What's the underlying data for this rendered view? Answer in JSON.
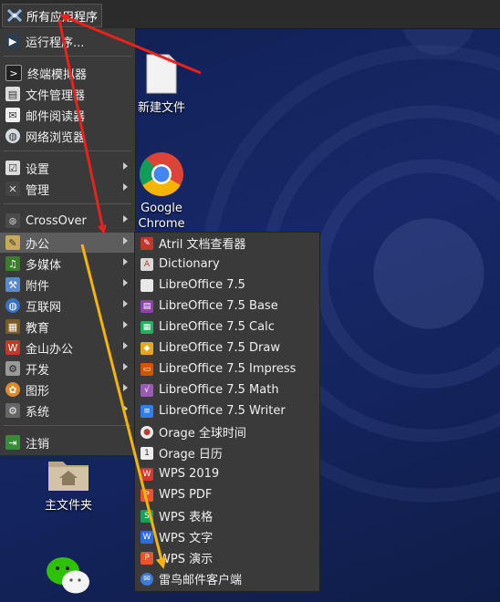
{
  "topbar": {
    "apps_label": "所有应用程序"
  },
  "menu": {
    "run": "运行程序...",
    "quick": [
      {
        "label": "终端模拟器",
        "icon": "terminal-icon"
      },
      {
        "label": "文件管理器",
        "icon": "file-manager-icon"
      },
      {
        "label": "邮件阅读器",
        "icon": "mail-reader-icon"
      },
      {
        "label": "网络浏览器",
        "icon": "web-browser-icon"
      }
    ],
    "settings": [
      {
        "label": "设置",
        "icon": "settings-icon"
      },
      {
        "label": "管理",
        "icon": "admin-icon"
      }
    ],
    "crossover": "CrossOver",
    "categories": [
      {
        "label": "办公",
        "icon": "office-icon"
      },
      {
        "label": "多媒体",
        "icon": "multimedia-icon"
      },
      {
        "label": "附件",
        "icon": "accessories-icon"
      },
      {
        "label": "互联网",
        "icon": "internet-icon"
      },
      {
        "label": "教育",
        "icon": "education-icon"
      },
      {
        "label": "金山办公",
        "icon": "kingsoft-office-icon"
      },
      {
        "label": "开发",
        "icon": "development-icon"
      },
      {
        "label": "图形",
        "icon": "graphics-icon"
      },
      {
        "label": "系统",
        "icon": "system-icon"
      }
    ],
    "logout": "注销"
  },
  "submenu": {
    "items": [
      {
        "label": "Atril 文档查看器",
        "icon": "atril-icon",
        "color": "#c0392b"
      },
      {
        "label": "Dictionary",
        "icon": "dictionary-icon",
        "color": "#d9d9d9"
      },
      {
        "label": "LibreOffice 7.5",
        "icon": "libreoffice-icon",
        "color": "#e0e0e0"
      },
      {
        "label": "LibreOffice 7.5 Base",
        "icon": "libreoffice-base-icon",
        "color": "#8e44ad"
      },
      {
        "label": "LibreOffice 7.5 Calc",
        "icon": "libreoffice-calc-icon",
        "color": "#27ae60"
      },
      {
        "label": "LibreOffice 7.5 Draw",
        "icon": "libreoffice-draw-icon",
        "color": "#e6a817"
      },
      {
        "label": "LibreOffice 7.5 Impress",
        "icon": "libreoffice-impress-icon",
        "color": "#d35400"
      },
      {
        "label": "LibreOffice 7.5 Math",
        "icon": "libreoffice-math-icon",
        "color": "#9b59b6"
      },
      {
        "label": "LibreOffice 7.5 Writer",
        "icon": "libreoffice-writer-icon",
        "color": "#2f80ed"
      },
      {
        "label": "Orage 全球时间",
        "icon": "orage-globaltime-icon",
        "color": "#eeeeee"
      },
      {
        "label": "Orage 日历",
        "icon": "orage-calendar-icon",
        "color": "#eeeeee"
      },
      {
        "label": "WPS 2019",
        "icon": "wps-2019-icon",
        "color": "#d33a2f"
      },
      {
        "label": "WPS PDF",
        "icon": "wps-pdf-icon",
        "color": "#e8542f"
      },
      {
        "label": "WPS 表格",
        "icon": "wps-spreadsheet-icon",
        "color": "#1f9d55"
      },
      {
        "label": "WPS 文字",
        "icon": "wps-writer-icon",
        "color": "#2d6be4"
      },
      {
        "label": "WPS 演示",
        "icon": "wps-presentation-icon",
        "color": "#e8542f"
      },
      {
        "label": "雷鸟邮件客户端",
        "icon": "thunderbird-icon",
        "color": "#3d7bd9"
      }
    ]
  },
  "desktop": {
    "new_file": "新建文件",
    "chrome_line1": "Google",
    "chrome_line2": "Chrome",
    "home_folder": "主文件夹"
  },
  "colors": {
    "panel": "#3a3a3a",
    "highlight": "#5d5d5d",
    "arrow_red": "#e8221c",
    "arrow_yellow": "#f5b400"
  }
}
